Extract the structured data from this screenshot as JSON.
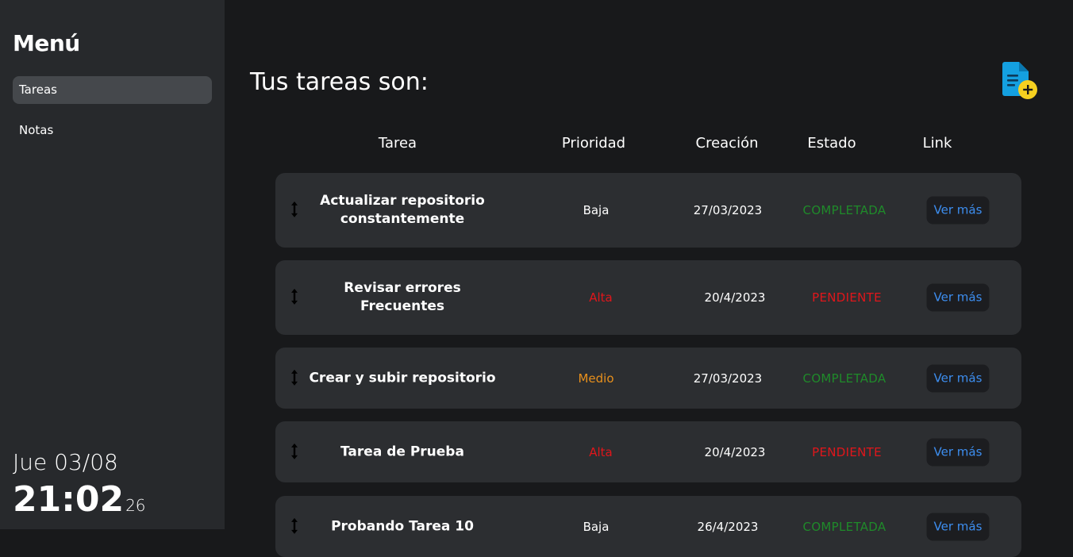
{
  "sidebar": {
    "title": "Menú",
    "items": [
      {
        "label": "Tareas",
        "active": true
      },
      {
        "label": "Notas",
        "active": false
      }
    ],
    "clock": {
      "date": "Jue 03/08",
      "time": "21:02",
      "seconds": "26"
    }
  },
  "main": {
    "title": "Tus tareas son:",
    "add_icon": "add-document-icon",
    "columns": {
      "task": "Tarea",
      "priority": "Prioridad",
      "created": "Creación",
      "status": "Estado",
      "link": "Link"
    },
    "rows": [
      {
        "task": "Actualizar repositorio constantemente",
        "priority": "Baja",
        "created": "27/03/2023",
        "status": "COMPLETADA",
        "link": "Ver más"
      },
      {
        "task": "Revisar errores Frecuentes",
        "priority": "Alta",
        "created": "20/4/2023",
        "status": "PENDIENTE",
        "link": "Ver más"
      },
      {
        "task": "Crear y subir repositorio",
        "priority": "Medio",
        "created": "27/03/2023",
        "status": "COMPLETADA",
        "link": "Ver más"
      },
      {
        "task": "Tarea de Prueba",
        "priority": "Alta",
        "created": "20/4/2023",
        "status": "PENDIENTE",
        "link": "Ver más"
      },
      {
        "task": "Probando Tarea 10",
        "priority": "Baja",
        "created": "26/4/2023",
        "status": "COMPLETADA",
        "link": "Ver más"
      }
    ]
  },
  "colors": {
    "priority_low": "#ffffff",
    "priority_high": "#e0161b",
    "priority_medium": "#e8901c",
    "status_done": "#1f8a2a",
    "status_pending": "#e0161b",
    "link": "#3d8ef0",
    "icon_blue": "#14a0e0",
    "icon_yellow": "#f5d020"
  }
}
